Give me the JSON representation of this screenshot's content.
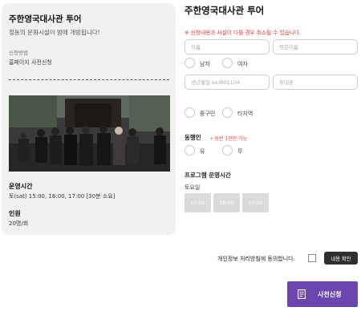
{
  "left_card": {
    "title": "주한영국대사관 투어",
    "subtitle": "정동의 문화시설이 밤에 개방됩니다!",
    "method_label": "신청방법",
    "method_value": "홈페이지 사전신청",
    "operation_title": "운영시간",
    "operation_value": "토(sat) 15:00, 16:00, 17:00 [30분 소요]",
    "capacity_title": "인원",
    "capacity_value": "20명/회"
  },
  "form": {
    "title": "주한영국대사관 투어",
    "notice": "※ 신청내용과 사실이 다를 경우 취소될 수 있습니다.",
    "name_placeholder": "이름",
    "english_name_placeholder": "영문이름",
    "gender_options": [
      "남자",
      "여자"
    ],
    "birth_placeholder": "생년월일 ex)801104",
    "phone_placeholder": "휴대폰",
    "region_options": [
      "중구민",
      "타지역"
    ],
    "companion_label": "동행인",
    "companion_note": "• 동반 1인만 가능",
    "companion_options": [
      "유",
      "무"
    ],
    "program_time_label": "프로그램 운영시간",
    "day_label": "토요일",
    "time_slots": [
      "15:00",
      "16:00",
      "17:00"
    ],
    "consent_text": "개인정보 처리방침에 동의합니다.",
    "view_button": "내용 확인",
    "apply_button": "사전신청"
  },
  "colors": {
    "accent": "#6b46b0",
    "notice": "#e23a3a",
    "card_bg": "#f1f1f1",
    "disabled_slot": "#dadada"
  }
}
